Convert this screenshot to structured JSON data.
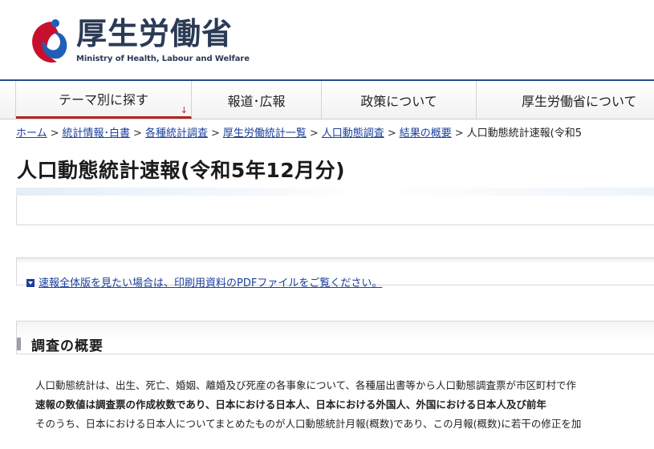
{
  "logo": {
    "title": "厚生労働省",
    "subtitle": "Ministry of Health, Labour and Welfare",
    "mark_colors": {
      "red": "#c8102e",
      "blue": "#1f5fb8"
    }
  },
  "gnav": {
    "items": [
      {
        "label": "テーマ別に探す",
        "active": true,
        "arrow": "↓"
      },
      {
        "label": "報道･広報"
      },
      {
        "label": "政策について"
      },
      {
        "label": "厚生労働省について"
      }
    ]
  },
  "breadcrumb": {
    "links": [
      "ホーム",
      "統計情報･白書",
      "各種統計調査",
      "厚生労働統計一覧",
      "人口動態調査",
      "結果の概要"
    ],
    "current": "人口動態統計速報(令和5",
    "separator": ">"
  },
  "page": {
    "title": "人口動態統計速報(令和5年12月分)"
  },
  "notice": {
    "pdf_link": "速報全体版を見たい場合は、印刷用資料のPDFファイルをご覧ください。"
  },
  "section": {
    "title": "調査の概要"
  },
  "body": {
    "p1": "人口動態統計は、出生、死亡、婚姻、離婚及び死産の各事象について、各種届出書等から人口動態調査票が市区町村で作",
    "p2": "速報の数値は調査票の作成枚数であり、日本における日本人、日本における外国人、外国における日本人及び前年",
    "p3": "そのうち、日本における日本人についてまとめたものが人口動態統計月報(概数)であり、この月報(概数)に若干の修正を加"
  },
  "colors": {
    "nav_top": "#1f4e8c",
    "nav_active": "#b3261e",
    "link": "#1a3f9c"
  }
}
